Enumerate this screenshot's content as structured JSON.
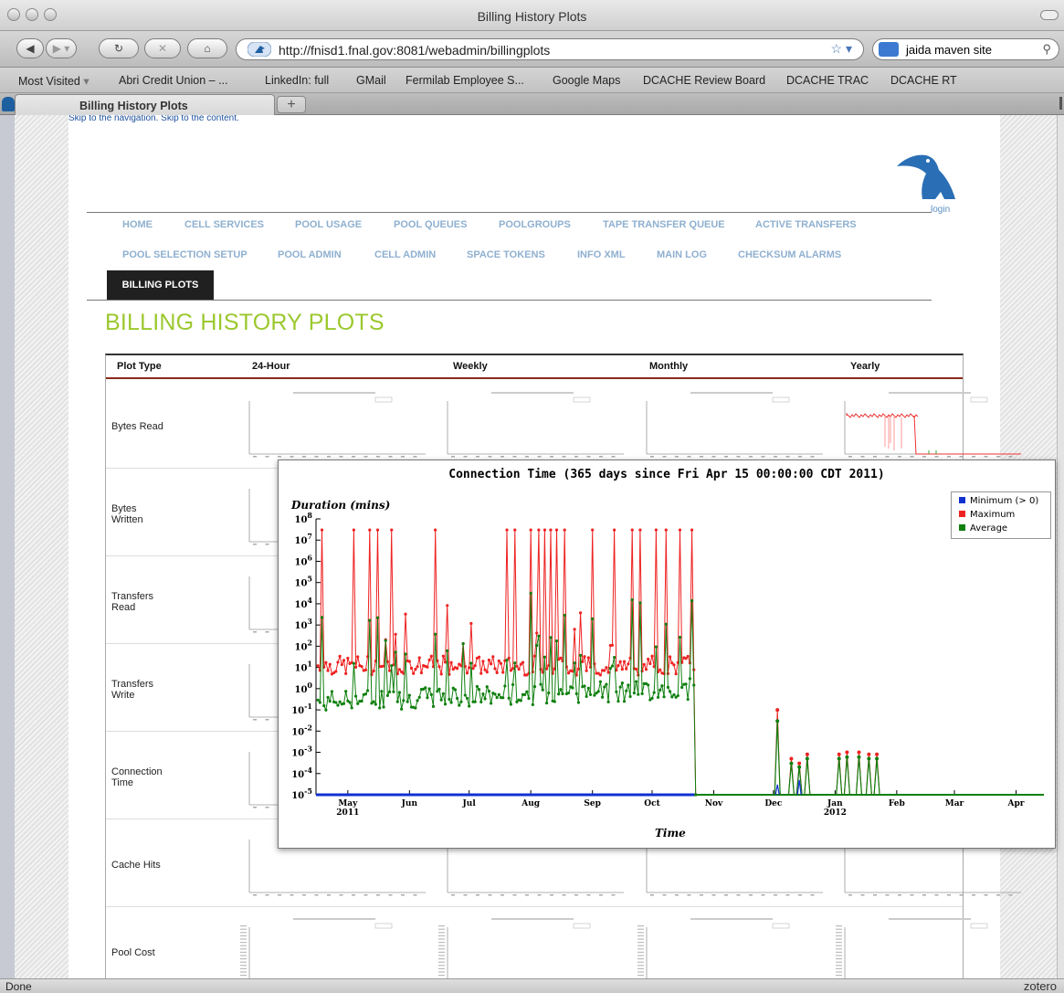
{
  "window": {
    "title": "Billing History Plots"
  },
  "navbar": {
    "url": "http://fnisd1.fnal.gov:8081/webadmin/billingplots",
    "search_text": "jaida maven site"
  },
  "bookmarks": [
    "Most Visited",
    "Abri Credit Union – ...",
    "LinkedIn: full",
    "GMail",
    "Fermilab Employee S...",
    "Google Maps",
    "DCACHE Review Board",
    "DCACHE TRAC",
    "DCACHE RT"
  ],
  "tab": {
    "label": "Billing History Plots",
    "new_tab": "+"
  },
  "page": {
    "skip_links": "Skip to the navigation. Skip to the content.",
    "login": "login",
    "nav_row1": [
      "HOME",
      "CELL SERVICES",
      "POOL USAGE",
      "POOL QUEUES",
      "POOLGROUPS",
      "TAPE TRANSFER QUEUE",
      "ACTIVE TRANSFERS"
    ],
    "nav_row2": [
      "POOL SELECTION SETUP",
      "POOL ADMIN",
      "CELL ADMIN",
      "SPACE TOKENS",
      "INFO XML",
      "MAIN LOG",
      "CHECKSUM ALARMS"
    ],
    "active_tab": "BILLING PLOTS",
    "title": "BILLING HISTORY PLOTS",
    "table": {
      "headers": [
        "Plot Type",
        "24-Hour",
        "Weekly",
        "Monthly",
        "Yearly"
      ],
      "rows": [
        [
          "Bytes Read"
        ],
        [
          "Bytes",
          "Written"
        ],
        [
          "Transfers",
          "Read"
        ],
        [
          "Transfers",
          "Write"
        ],
        [
          "Connection",
          "Time"
        ],
        [
          "Cache Hits"
        ],
        [
          "Pool Cost"
        ]
      ]
    }
  },
  "popup": {
    "chart_data": {
      "type": "line",
      "title": "Connection Time (365 days since Fri Apr 15 00:00:00 CDT 2011)",
      "ylabel": "Duration (mins)",
      "xlabel": "Time",
      "y_scale": "log",
      "ylim": [
        1e-05,
        100000000.0
      ],
      "y_ticks": [
        "10^-5",
        "10^-4",
        "10^-3",
        "10^-2",
        "10^-1",
        "10^0",
        "10^1",
        "10^2",
        "10^3",
        "10^4",
        "10^5",
        "10^6",
        "10^7",
        "10^8"
      ],
      "x_ticks": [
        "May",
        "Jun",
        "Jul",
        "Aug",
        "Sep",
        "Oct",
        "Nov",
        "Dec",
        "Jan",
        "Feb",
        "Mar",
        "Apr"
      ],
      "x_years": [
        "2011",
        "2012"
      ],
      "x_range": [
        "2011-04-15",
        "2012-04-15"
      ],
      "grid": false,
      "legend_placement": "top-right",
      "series": [
        {
          "name": "Minimum (> 0)",
          "color": "#1030d0"
        },
        {
          "name": "Maximum",
          "color": "#ee2222"
        },
        {
          "name": "Average",
          "color": "#108010"
        }
      ],
      "spike_dates_max": [
        "2011-04-18",
        "2011-05-04",
        "2011-05-12",
        "2011-05-16",
        "2011-05-23",
        "2011-06-14",
        "2011-07-20",
        "2011-07-24",
        "2011-08-01",
        "2011-08-05",
        "2011-08-08",
        "2011-08-11",
        "2011-08-14",
        "2011-08-18",
        "2011-09-01",
        "2011-09-12",
        "2011-09-21",
        "2011-09-25",
        "2011-10-03",
        "2011-10-08",
        "2011-10-15",
        "2011-10-21"
      ],
      "active_end_date": "2011-10-22",
      "late_bursts": [
        {
          "date": "2011-12-03",
          "max": 0.1,
          "avg": 0.03,
          "min": 3e-05
        },
        {
          "date": "2011-12-10",
          "max": 0.0005,
          "avg": 0.0003
        },
        {
          "date": "2011-12-14",
          "max": 0.0003,
          "avg": 0.0002,
          "min": 5e-05
        },
        {
          "date": "2011-12-18",
          "max": 0.0008,
          "avg": 0.0005
        },
        {
          "date": "2012-01-03",
          "max": 0.0008,
          "avg": 0.0005
        },
        {
          "date": "2012-01-07",
          "max": 0.001,
          "avg": 0.0006
        },
        {
          "date": "2012-01-13",
          "max": 0.001,
          "avg": 0.0006
        },
        {
          "date": "2012-01-18",
          "max": 0.0008,
          "avg": 0.0005
        },
        {
          "date": "2012-01-22",
          "max": 0.0008,
          "avg": 0.0005
        }
      ]
    }
  },
  "status": {
    "text": "Done",
    "zotero": "zotero"
  }
}
